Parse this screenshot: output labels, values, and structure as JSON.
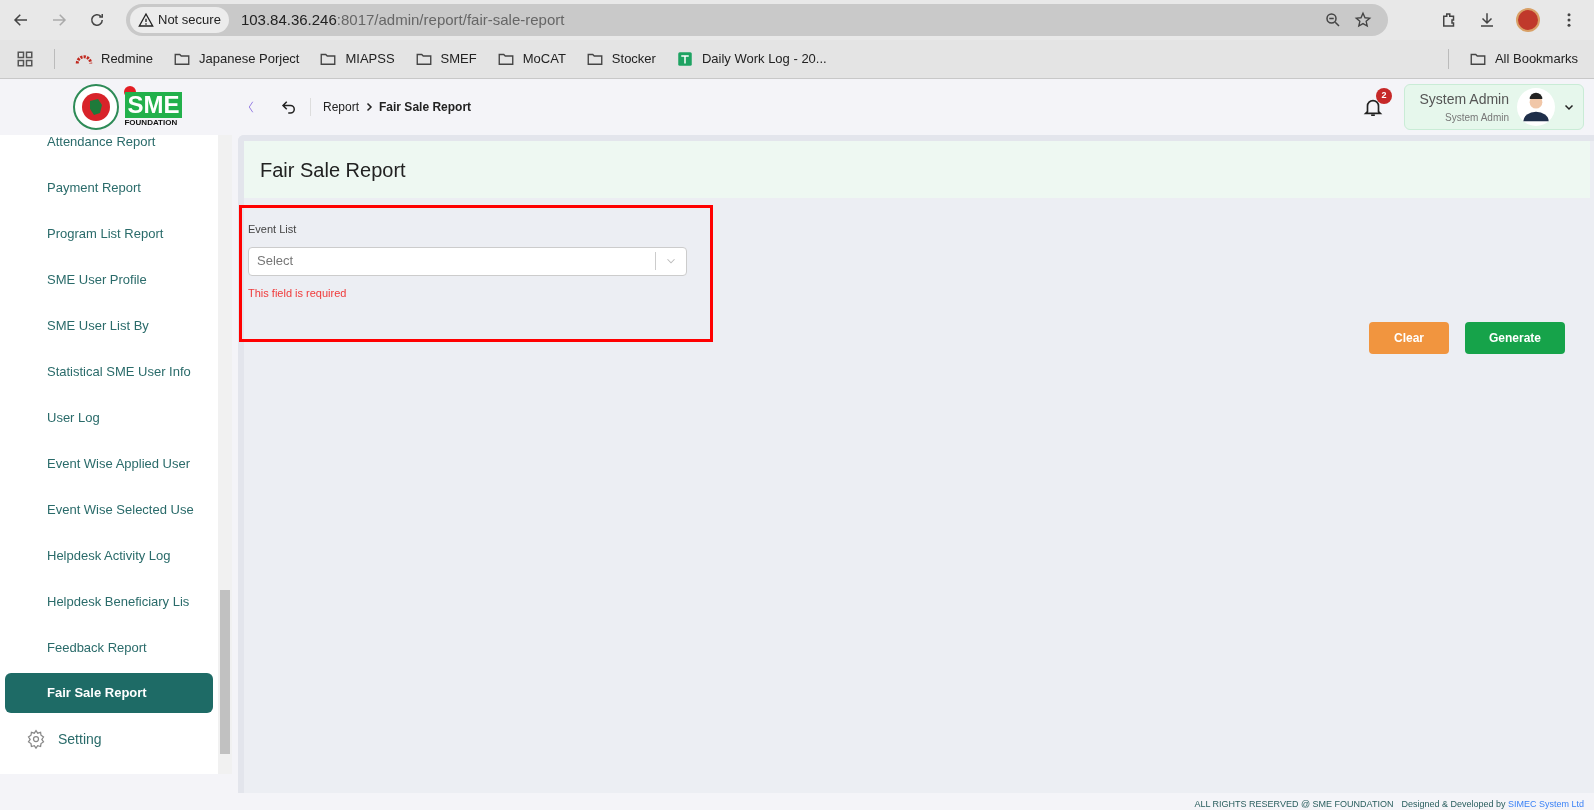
{
  "browser": {
    "security": "Not secure",
    "host": "103.84.36.246",
    "path": ":8017/admin/report/fair-sale-report",
    "bookmarks": [
      {
        "label": "Redmine",
        "kind": "redmine"
      },
      {
        "label": "Japanese Porject",
        "kind": "folder"
      },
      {
        "label": "MIAPSS",
        "kind": "folder"
      },
      {
        "label": "SMEF",
        "kind": "folder"
      },
      {
        "label": "MoCAT",
        "kind": "folder"
      },
      {
        "label": "Stocker",
        "kind": "folder"
      },
      {
        "label": "Daily Work Log - 20...",
        "kind": "sheet"
      }
    ],
    "all_bookmarks": "All Bookmarks"
  },
  "logo": {
    "letters": "SME",
    "subtitle": "FOUNDATION"
  },
  "header": {
    "breadcrumb": [
      "Report",
      "Fair Sale Report"
    ],
    "notifications": "2",
    "user": {
      "name": "System Admin",
      "role": "System Admin"
    }
  },
  "sidebar": {
    "items": [
      {
        "label": "Attendance Report",
        "selected": false
      },
      {
        "label": "Payment Report",
        "selected": false
      },
      {
        "label": "Program List Report",
        "selected": false
      },
      {
        "label": "SME User Profile",
        "selected": false
      },
      {
        "label": "SME User List By",
        "selected": false
      },
      {
        "label": "Statistical SME User Info",
        "selected": false
      },
      {
        "label": "User Log",
        "selected": false
      },
      {
        "label": "Event Wise Applied User",
        "selected": false
      },
      {
        "label": "Event Wise Selected Use",
        "selected": false
      },
      {
        "label": "Helpdesk Activity Log",
        "selected": false
      },
      {
        "label": "Helpdesk Beneficiary Lis",
        "selected": false
      },
      {
        "label": "Feedback Report",
        "selected": false
      },
      {
        "label": "Fair Sale Report",
        "selected": true
      }
    ],
    "setting": "Setting"
  },
  "page": {
    "title": "Fair Sale Report",
    "field": {
      "label": "Event List",
      "placeholder": "Select",
      "error": "This field is required"
    },
    "buttons": [
      {
        "label": "Clear",
        "kind": "clear"
      },
      {
        "label": "Generate",
        "kind": "generate"
      }
    ]
  },
  "footer": {
    "rights": "ALL RIGHTS RESERVED @ SME FOUNDATION",
    "designed": "Designed & Developed by",
    "company": "SIMEC System Ltd"
  }
}
